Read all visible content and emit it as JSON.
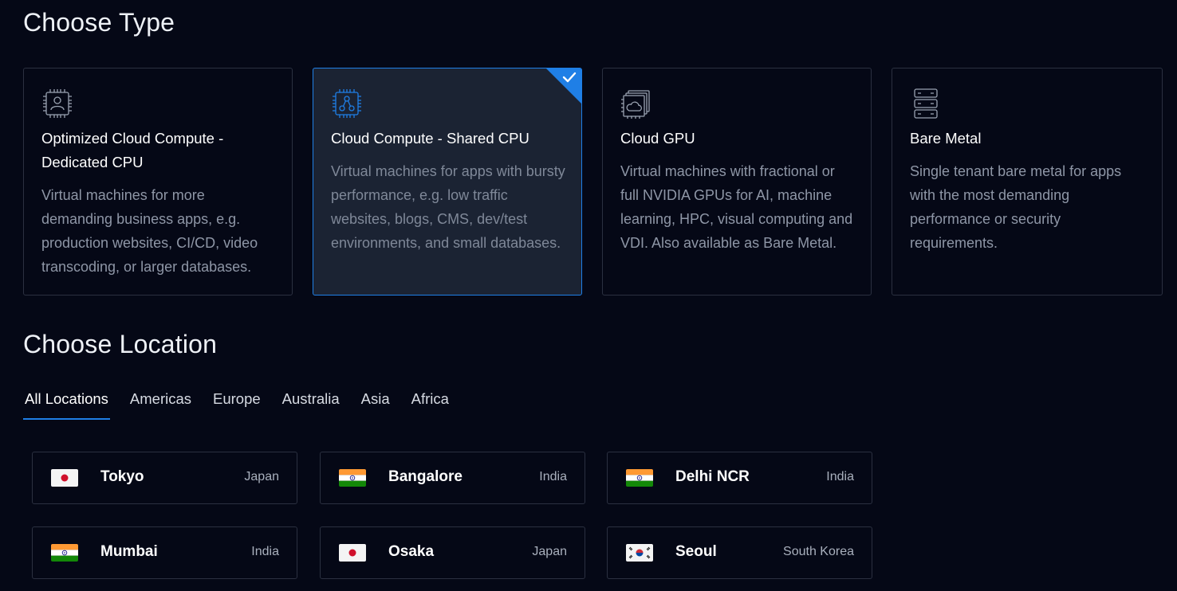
{
  "choose_type": {
    "title": "Choose Type",
    "cards": [
      {
        "title_line1": "Optimized Cloud Compute -",
        "title_line2": "Dedicated CPU",
        "description": "Virtual machines for more demanding business apps, e.g. production websites, CI/CD, video transcoding, or larger databases.",
        "icon": "cpu-user-icon",
        "selected": false
      },
      {
        "title_line1": "Cloud Compute - Shared CPU",
        "title_line2": "",
        "description": "Virtual machines for apps with bursty performance, e.g. low traffic websites, blogs, CMS, dev/test environments, and small databases.",
        "icon": "cpu-share-icon",
        "selected": true
      },
      {
        "title_line1": "Cloud GPU",
        "title_line2": "",
        "description": "Virtual machines with fractional or full NVIDIA GPUs for AI, machine learning, HPC, visual computing and VDI. Also available as Bare Metal.",
        "icon": "gpu-cloud-icon",
        "selected": false
      },
      {
        "title_line1": "Bare Metal",
        "title_line2": "",
        "description": "Single tenant bare metal for apps with the most demanding performance or security requirements.",
        "icon": "server-stack-icon",
        "selected": false
      }
    ]
  },
  "choose_location": {
    "title": "Choose Location",
    "tabs": [
      "All Locations",
      "Americas",
      "Europe",
      "Australia",
      "Asia",
      "Africa"
    ],
    "active_tab": "All Locations",
    "locations": [
      {
        "city": "Tokyo",
        "country": "Japan",
        "flag": "japan-flag-icon"
      },
      {
        "city": "Bangalore",
        "country": "India",
        "flag": "india-flag-icon"
      },
      {
        "city": "Delhi NCR",
        "country": "India",
        "flag": "india-flag-icon"
      },
      {
        "city": "Mumbai",
        "country": "India",
        "flag": "india-flag-icon"
      },
      {
        "city": "Osaka",
        "country": "Japan",
        "flag": "japan-flag-icon"
      },
      {
        "city": "Seoul",
        "country": "South Korea",
        "flag": "south-korea-flag-icon"
      }
    ]
  },
  "colors": {
    "background": "#050816",
    "accent": "#1f7fe6",
    "selected_card_bg": "#1b2333",
    "border": "#2b3040",
    "muted_text": "#8e96a6"
  }
}
